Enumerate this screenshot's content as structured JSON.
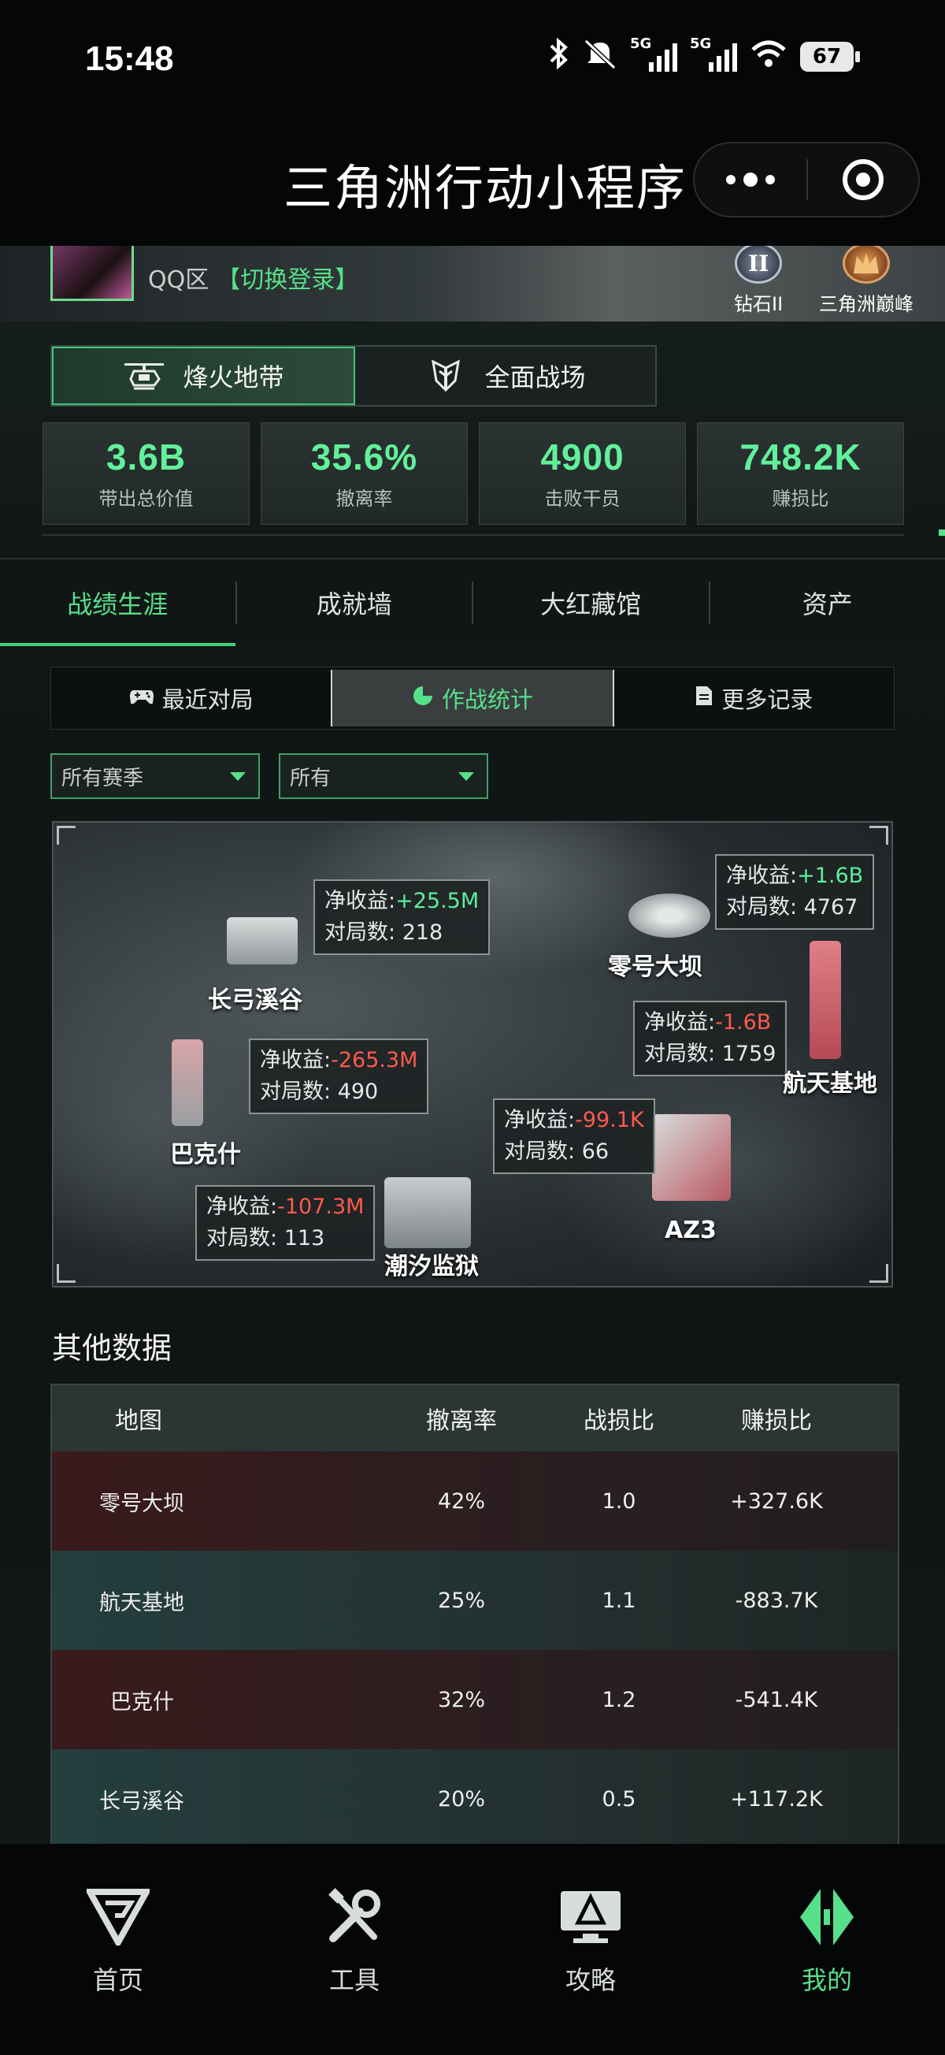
{
  "status_bar": {
    "time": "15:48",
    "network1": "5G",
    "network2": "5G",
    "battery": "67"
  },
  "header": {
    "title": "三角洲行动小程序"
  },
  "profile": {
    "region": "QQ区",
    "switch_login": "【切换登录】",
    "ranks": [
      {
        "label": "钻石II",
        "badge": "II"
      },
      {
        "label": "三角洲巅峰",
        "badge": ""
      }
    ]
  },
  "modes": [
    {
      "label": "烽火地带",
      "active": true
    },
    {
      "label": "全面战场",
      "active": false
    }
  ],
  "stats": [
    {
      "value": "3.6B",
      "label": "带出总价值"
    },
    {
      "value": "35.6%",
      "label": "撤离率"
    },
    {
      "value": "4900",
      "label": "击败干员"
    },
    {
      "value": "748.2K",
      "label": "赚损比"
    }
  ],
  "tabs": [
    {
      "label": "战绩生涯",
      "active": true
    },
    {
      "label": "成就墙",
      "active": false
    },
    {
      "label": "大红藏馆",
      "active": false
    },
    {
      "label": "资产",
      "active": false
    }
  ],
  "subtabs": [
    {
      "label": "最近对局",
      "icon": "gamepad-icon"
    },
    {
      "label": "作战统计",
      "icon": "pie-chart-icon",
      "active": true
    },
    {
      "label": "更多记录",
      "icon": "document-icon"
    }
  ],
  "filters": {
    "season": "所有赛季",
    "mode": "所有"
  },
  "map": {
    "net_label": "净收益:",
    "games_label": "对局数: ",
    "locations": [
      {
        "name": "长弓溪谷",
        "net": "+25.5M",
        "games": "218",
        "trend": "pos"
      },
      {
        "name": "零号大坝",
        "net": "+1.6B",
        "games": "4767",
        "trend": "pos"
      },
      {
        "name": "航天基地",
        "net": "-1.6B",
        "games": "1759",
        "trend": "neg"
      },
      {
        "name": "巴克什",
        "net": "-265.3M",
        "games": "490",
        "trend": "neg"
      },
      {
        "name": "AZ3",
        "net": "-99.1K",
        "games": "66",
        "trend": "neg"
      },
      {
        "name": "潮汐监狱",
        "net": "-107.3M",
        "games": "113",
        "trend": "neg"
      }
    ]
  },
  "other": {
    "title": "其他数据",
    "headers": [
      "地图",
      "撤离率",
      "战损比",
      "赚损比"
    ],
    "rows": [
      {
        "map": "零号大坝",
        "rate": "42%",
        "ratio": "1.0",
        "pl": "+327.6K"
      },
      {
        "map": "航天基地",
        "rate": "25%",
        "ratio": "1.1",
        "pl": "-883.7K"
      },
      {
        "map": "巴克什",
        "rate": "32%",
        "ratio": "1.2",
        "pl": "-541.4K"
      },
      {
        "map": "长弓溪谷",
        "rate": "20%",
        "ratio": "0.5",
        "pl": "+117.2K"
      }
    ]
  },
  "nav": [
    {
      "label": "首页",
      "icon": "home-logo-icon"
    },
    {
      "label": "工具",
      "icon": "tools-icon"
    },
    {
      "label": "攻略",
      "icon": "guide-monitor-icon"
    },
    {
      "label": "我的",
      "icon": "profile-logo-icon",
      "active": true
    }
  ],
  "colors": {
    "accent_green": "#56e08a",
    "positive": "#5cf09a",
    "negative": "#ff5a4e"
  }
}
